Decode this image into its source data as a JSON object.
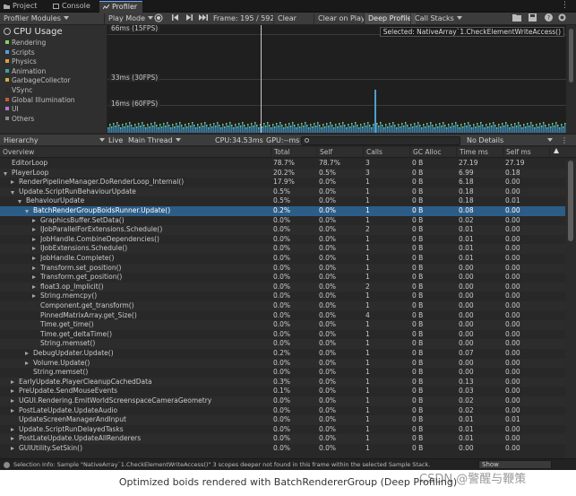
{
  "tabs": [
    {
      "label": "Project",
      "icon": "folder-icon",
      "active": false
    },
    {
      "label": "Console",
      "icon": "console-icon",
      "active": false
    },
    {
      "label": "Profiler",
      "icon": "profiler-icon",
      "active": true
    }
  ],
  "toolbar": {
    "modules_label": "Profiler Modules",
    "play_mode": "Play Mode",
    "frame_label": "Frame: 195 / 592",
    "clear": "Clear",
    "clear_on_play": "Clear on Play",
    "deep_profile": "Deep Profile",
    "call_stacks": "Call Stacks"
  },
  "modules": {
    "title": "CPU Usage",
    "items": [
      {
        "label": "Rendering",
        "color": "#7fd36a"
      },
      {
        "label": "Scripts",
        "color": "#4fa3e0"
      },
      {
        "label": "Physics",
        "color": "#e0a13a"
      },
      {
        "label": "Animation",
        "color": "#3aa3a0"
      },
      {
        "label": "GarbageCollector",
        "color": "#c8b43a"
      },
      {
        "label": "VSync",
        "color": "#2a2a2a"
      },
      {
        "label": "Global Illumination",
        "color": "#c85a3a"
      },
      {
        "label": "UI",
        "color": "#b07ad0"
      },
      {
        "label": "Others",
        "color": "#8a8a8a"
      }
    ]
  },
  "graph": {
    "labels": [
      "66ms (15FPS)",
      "33ms (30FPS)",
      "16ms (60FPS)"
    ],
    "selected": "Selected: NativeArray`1.CheckElementWriteAccess()"
  },
  "hierarchy_bar": {
    "view": "Hierarchy",
    "live": "Live",
    "thread": "Main Thread",
    "cpu": "CPU:34.53ms",
    "gpu": "GPU:--ms",
    "details": "No Details"
  },
  "columns": [
    "Overview",
    "Total",
    "Self",
    "Calls",
    "GC Alloc",
    "Time ms",
    "Self ms"
  ],
  "rows": [
    {
      "indent": 0,
      "exp": "",
      "name": "EditorLoop",
      "total": "78.7%",
      "self": "78.7%",
      "calls": "3",
      "gc": "0 B",
      "time": "27.19",
      "selfms": "27.19"
    },
    {
      "indent": 0,
      "exp": "open",
      "name": "PlayerLoop",
      "total": "20.2%",
      "self": "0.5%",
      "calls": "3",
      "gc": "0 B",
      "time": "6.99",
      "selfms": "0.18"
    },
    {
      "indent": 1,
      "exp": "closed",
      "name": "RenderPipelineManager.DoRenderLoop_Internal()",
      "total": "17.9%",
      "self": "0.0%",
      "calls": "1",
      "gc": "0 B",
      "time": "6.18",
      "selfms": "0.00"
    },
    {
      "indent": 1,
      "exp": "open",
      "name": "Update.ScriptRunBehaviourUpdate",
      "total": "0.5%",
      "self": "0.0%",
      "calls": "1",
      "gc": "0 B",
      "time": "0.18",
      "selfms": "0.00"
    },
    {
      "indent": 2,
      "exp": "open",
      "name": "BehaviourUpdate",
      "total": "0.5%",
      "self": "0.0%",
      "calls": "1",
      "gc": "0 B",
      "time": "0.18",
      "selfms": "0.01"
    },
    {
      "indent": 3,
      "exp": "open",
      "name": "BatchRenderGroupBoidsRunner.Update()",
      "total": "0.2%",
      "self": "0.0%",
      "calls": "1",
      "gc": "0 B",
      "time": "0.08",
      "selfms": "0.00",
      "selected": true
    },
    {
      "indent": 4,
      "exp": "closed",
      "name": "GraphicsBuffer.SetData()",
      "total": "0.0%",
      "self": "0.0%",
      "calls": "1",
      "gc": "0 B",
      "time": "0.02",
      "selfms": "0.00"
    },
    {
      "indent": 4,
      "exp": "closed",
      "name": "IJobParallelForExtensions.Schedule()",
      "total": "0.0%",
      "self": "0.0%",
      "calls": "2",
      "gc": "0 B",
      "time": "0.01",
      "selfms": "0.00"
    },
    {
      "indent": 4,
      "exp": "closed",
      "name": "JobHandle.CombineDependencies()",
      "total": "0.0%",
      "self": "0.0%",
      "calls": "1",
      "gc": "0 B",
      "time": "0.01",
      "selfms": "0.00"
    },
    {
      "indent": 4,
      "exp": "closed",
      "name": "IJobExtensions.Schedule()",
      "total": "0.0%",
      "self": "0.0%",
      "calls": "1",
      "gc": "0 B",
      "time": "0.01",
      "selfms": "0.00"
    },
    {
      "indent": 4,
      "exp": "closed",
      "name": "JobHandle.Complete()",
      "total": "0.0%",
      "self": "0.0%",
      "calls": "1",
      "gc": "0 B",
      "time": "0.01",
      "selfms": "0.00"
    },
    {
      "indent": 4,
      "exp": "closed",
      "name": "Transform.set_position()",
      "total": "0.0%",
      "self": "0.0%",
      "calls": "1",
      "gc": "0 B",
      "time": "0.00",
      "selfms": "0.00"
    },
    {
      "indent": 4,
      "exp": "closed",
      "name": "Transform.get_position()",
      "total": "0.0%",
      "self": "0.0%",
      "calls": "1",
      "gc": "0 B",
      "time": "0.00",
      "selfms": "0.00"
    },
    {
      "indent": 4,
      "exp": "closed",
      "name": "float3.op_Implicit()",
      "total": "0.0%",
      "self": "0.0%",
      "calls": "2",
      "gc": "0 B",
      "time": "0.00",
      "selfms": "0.00"
    },
    {
      "indent": 4,
      "exp": "closed",
      "name": "String.memcpy()",
      "total": "0.0%",
      "self": "0.0%",
      "calls": "1",
      "gc": "0 B",
      "time": "0.00",
      "selfms": "0.00"
    },
    {
      "indent": 4,
      "exp": "",
      "name": "Component.get_transform()",
      "total": "0.0%",
      "self": "0.0%",
      "calls": "1",
      "gc": "0 B",
      "time": "0.00",
      "selfms": "0.00"
    },
    {
      "indent": 4,
      "exp": "",
      "name": "PinnedMatrixArray.get_Size()",
      "total": "0.0%",
      "self": "0.0%",
      "calls": "4",
      "gc": "0 B",
      "time": "0.00",
      "selfms": "0.00"
    },
    {
      "indent": 4,
      "exp": "",
      "name": "Time.get_time()",
      "total": "0.0%",
      "self": "0.0%",
      "calls": "1",
      "gc": "0 B",
      "time": "0.00",
      "selfms": "0.00"
    },
    {
      "indent": 4,
      "exp": "",
      "name": "Time.get_deltaTime()",
      "total": "0.0%",
      "self": "0.0%",
      "calls": "1",
      "gc": "0 B",
      "time": "0.00",
      "selfms": "0.00"
    },
    {
      "indent": 4,
      "exp": "",
      "name": "String.memset()",
      "total": "0.0%",
      "self": "0.0%",
      "calls": "1",
      "gc": "0 B",
      "time": "0.00",
      "selfms": "0.00"
    },
    {
      "indent": 3,
      "exp": "closed",
      "name": "DebugUpdater.Update()",
      "total": "0.2%",
      "self": "0.0%",
      "calls": "1",
      "gc": "0 B",
      "time": "0.07",
      "selfms": "0.00"
    },
    {
      "indent": 3,
      "exp": "closed",
      "name": "Volume.Update()",
      "total": "0.0%",
      "self": "0.0%",
      "calls": "1",
      "gc": "0 B",
      "time": "0.00",
      "selfms": "0.00"
    },
    {
      "indent": 3,
      "exp": "",
      "name": "String.memset()",
      "total": "0.0%",
      "self": "0.0%",
      "calls": "1",
      "gc": "0 B",
      "time": "0.00",
      "selfms": "0.00"
    },
    {
      "indent": 1,
      "exp": "closed",
      "name": "EarlyUpdate.PlayerCleanupCachedData",
      "total": "0.3%",
      "self": "0.0%",
      "calls": "1",
      "gc": "0 B",
      "time": "0.13",
      "selfms": "0.00"
    },
    {
      "indent": 1,
      "exp": "closed",
      "name": "PreUpdate.SendMouseEvents",
      "total": "0.1%",
      "self": "0.0%",
      "calls": "1",
      "gc": "0 B",
      "time": "0.03",
      "selfms": "0.00"
    },
    {
      "indent": 1,
      "exp": "closed",
      "name": "UGUI.Rendering.EmitWorldScreenspaceCameraGeometry",
      "total": "0.0%",
      "self": "0.0%",
      "calls": "1",
      "gc": "0 B",
      "time": "0.02",
      "selfms": "0.00"
    },
    {
      "indent": 1,
      "exp": "closed",
      "name": "PostLateUpdate.UpdateAudio",
      "total": "0.0%",
      "self": "0.0%",
      "calls": "1",
      "gc": "0 B",
      "time": "0.02",
      "selfms": "0.00"
    },
    {
      "indent": 1,
      "exp": "",
      "name": "UpdateScreenManagerAndInput",
      "total": "0.0%",
      "self": "0.0%",
      "calls": "1",
      "gc": "0 B",
      "time": "0.01",
      "selfms": "0.01"
    },
    {
      "indent": 1,
      "exp": "closed",
      "name": "Update.ScriptRunDelayedTasks",
      "total": "0.0%",
      "self": "0.0%",
      "calls": "1",
      "gc": "0 B",
      "time": "0.01",
      "selfms": "0.00"
    },
    {
      "indent": 1,
      "exp": "closed",
      "name": "PostLateUpdate.UpdateAllRenderers",
      "total": "0.0%",
      "self": "0.0%",
      "calls": "1",
      "gc": "0 B",
      "time": "0.01",
      "selfms": "0.00"
    },
    {
      "indent": 1,
      "exp": "closed",
      "name": "GUIUtility.SetSkin()",
      "total": "0.0%",
      "self": "0.0%",
      "calls": "1",
      "gc": "0 B",
      "time": "0.00",
      "selfms": "0.00"
    }
  ],
  "status": {
    "text": "Selection Info: Sample \"NativeArray`1.CheckElementWriteAccess()\" 3 scopes deeper not found in this frame within the selected Sample Stack.",
    "show": "Show"
  },
  "watermark": "CSDN @警醒与鞭策",
  "caption": "Optimized boids rendered with BatchRendererGroup (Deep Profiling)"
}
